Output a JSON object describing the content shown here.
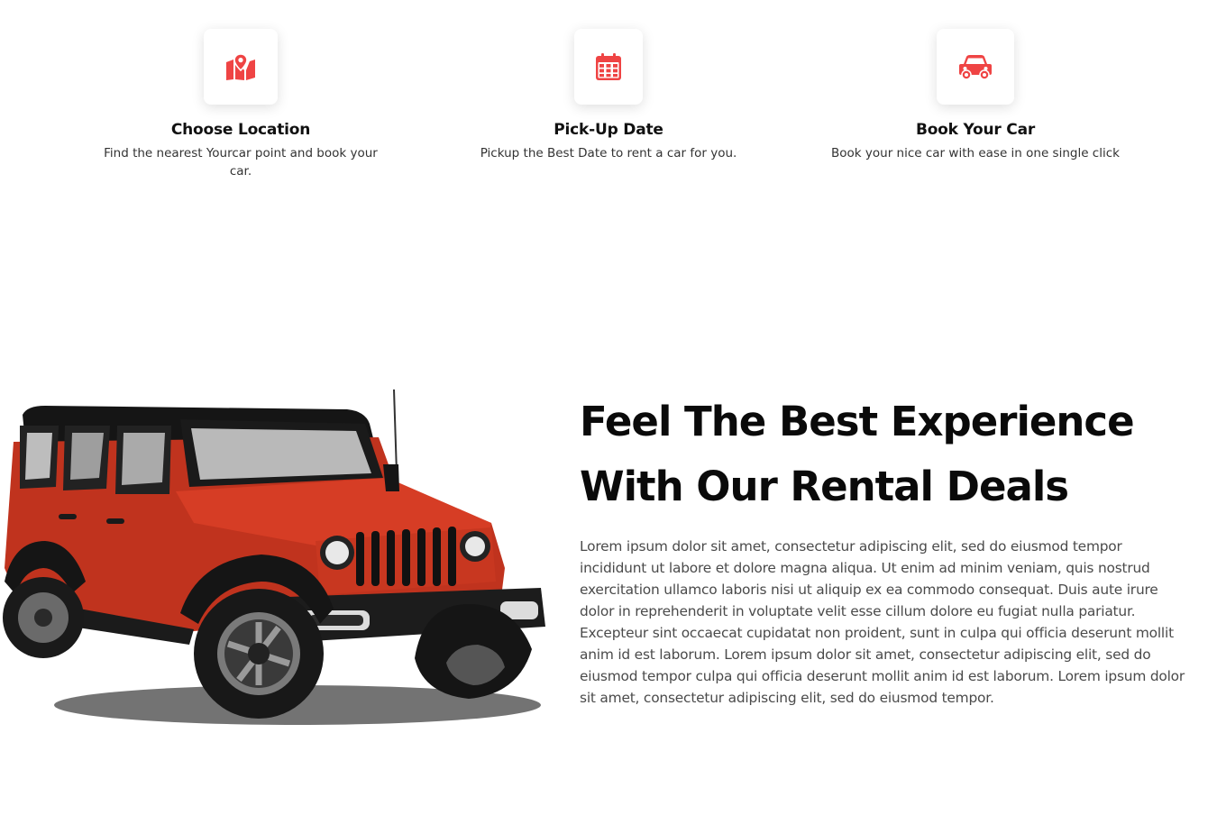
{
  "colors": {
    "accent": "#ef4444",
    "heading": "#0a0a0a",
    "body_text": "#4a4a4a"
  },
  "steps": [
    {
      "icon": "map-pin-icon",
      "title": "Choose Location",
      "description": "Find the nearest Yourcar point and book your car."
    },
    {
      "icon": "calendar-icon",
      "title": "Pick-Up Date",
      "description": "Pickup the Best Date to rent a car for you."
    },
    {
      "icon": "car-icon",
      "title": "Book Your Car",
      "description": "Book your nice car with ease in one single click"
    }
  ],
  "promo": {
    "image": "red-jeep-image",
    "headline_line1": "Feel The Best Experience",
    "headline_line2": "With Our Rental Deals",
    "body": "Lorem ipsum dolor sit amet, consectetur adipiscing elit, sed do eiusmod tempor incididunt ut labore et dolore magna aliqua. Ut enim ad minim veniam, quis nostrud exercitation ullamco laboris nisi ut aliquip ex ea commodo consequat. Duis aute irure dolor in reprehenderit in voluptate velit esse cillum dolore eu fugiat nulla pariatur. Excepteur sint occaecat cupidatat non proident, sunt in culpa qui officia deserunt mollit anim id est laborum. Lorem ipsum dolor sit amet, consectetur adipiscing elit, sed do eiusmod tempor culpa qui officia deserunt mollit anim id est laborum. Lorem ipsum dolor sit amet, consectetur adipiscing elit, sed do eiusmod tempor."
  }
}
